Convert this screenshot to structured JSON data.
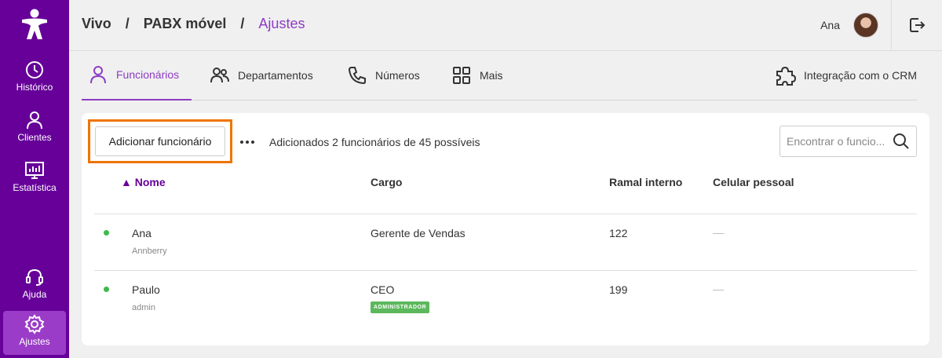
{
  "sidebar": {
    "items": [
      {
        "label": "Histórico",
        "icon": "clock-icon"
      },
      {
        "label": "Clientes",
        "icon": "person-icon"
      },
      {
        "label": "Estatística",
        "icon": "chart-icon"
      },
      {
        "label": "Ajuda",
        "icon": "headset-icon"
      },
      {
        "label": "Ajustes",
        "icon": "gear-icon",
        "active": true
      }
    ]
  },
  "header": {
    "breadcrumb": [
      "Vivo",
      "/",
      "PABX móvel",
      "/",
      "Ajustes"
    ],
    "user_name": "Ana"
  },
  "tabs": [
    {
      "label": "Funcionários",
      "icon": "person-icon",
      "active": true
    },
    {
      "label": "Departamentos",
      "icon": "people-icon"
    },
    {
      "label": "Números",
      "icon": "phone-icon"
    },
    {
      "label": "Mais",
      "icon": "grid-icon"
    }
  ],
  "crm_tab": {
    "label": "Integração com o CRM",
    "icon": "puzzle-icon"
  },
  "toolbar": {
    "add_label": "Adicionar funcionário",
    "count_text": "Adicionados 2 funcionários de 45 possíveis",
    "search_placeholder": "Encontrar o funcio..."
  },
  "table": {
    "columns": [
      "▲ Nome",
      "Cargo",
      "Ramal interno",
      "Celular pessoal"
    ],
    "rows": [
      {
        "name": "Ana",
        "login": "Annberry",
        "role": "Gerente de Vendas",
        "badge": "",
        "ext": "122",
        "mobile": "—",
        "status_color": "#3dba4a"
      },
      {
        "name": "Paulo",
        "login": "admin",
        "role": "CEO",
        "badge": "ADMINISTRADOR",
        "ext": "199",
        "mobile": "—",
        "status_color": "#3dba4a"
      }
    ]
  },
  "colors": {
    "brand": "#660099",
    "accent": "#8d3cc4",
    "highlight": "#f07400",
    "online": "#3dba4a"
  }
}
